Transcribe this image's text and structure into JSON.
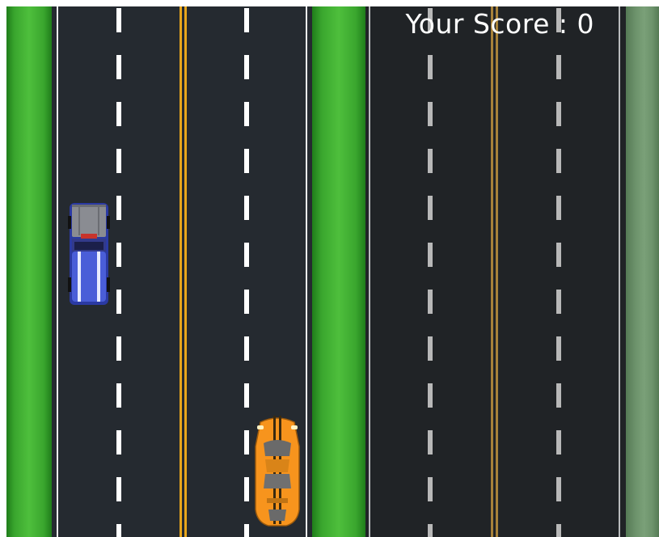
{
  "game": {
    "score_label": "Your Score : 0",
    "score": 0
  },
  "colors": {
    "grass": "#3aa62e",
    "road_left": "#252a30",
    "road_right": "#202326",
    "lane_yellow": "#e8a61c",
    "lane_white": "#ffffff",
    "player_car": "#f7941d",
    "enemy_truck": "#3d4fc4"
  },
  "entities": {
    "player": {
      "type": "orange-sports-car"
    },
    "enemy": {
      "type": "blue-pickup-truck"
    }
  }
}
